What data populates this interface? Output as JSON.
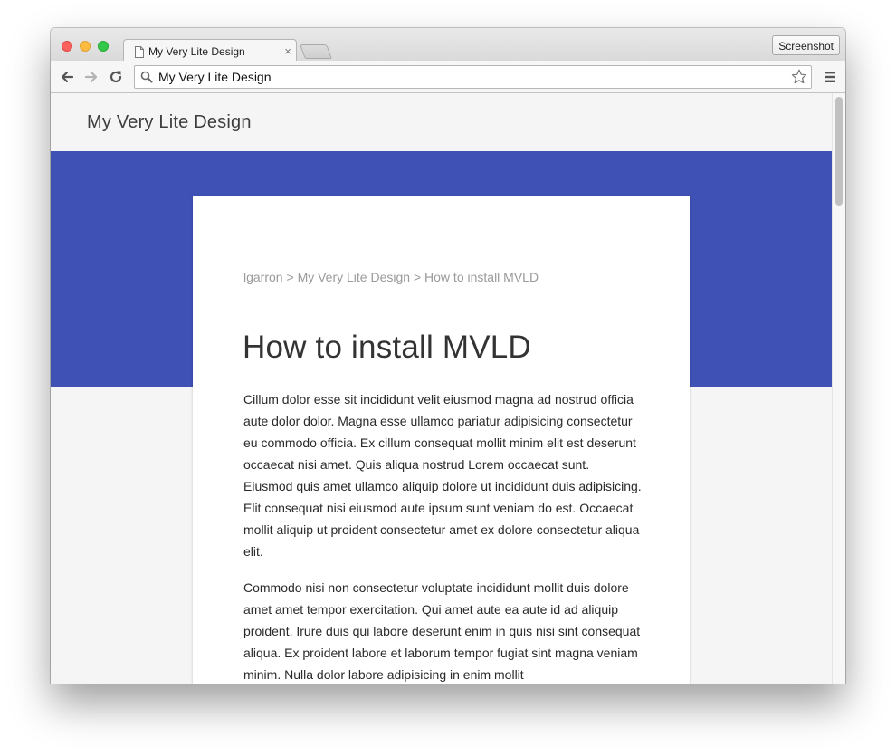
{
  "browser": {
    "tab_title": "My Very Lite Design",
    "tab_close": "×",
    "address": "My Very Lite Design",
    "screenshot_label": "Screenshot"
  },
  "site": {
    "title": "My Very Lite Design",
    "accent_color": "#3f51b5"
  },
  "breadcrumb": {
    "items": [
      "lgarron",
      "My Very Lite Design",
      "How to install MVLD"
    ],
    "separator": ">"
  },
  "article": {
    "title": "How to install MVLD",
    "paragraphs": [
      "Cillum dolor esse sit incididunt velit eiusmod magna ad nostrud officia aute dolor dolor. Magna esse ullamco pariatur adipisicing consectetur eu commodo officia. Ex cillum consequat mollit minim elit est deserunt occaecat nisi amet. Quis aliqua nostrud Lorem occaecat sunt. Eiusmod quis amet ullamco aliquip dolore ut incididunt duis adipisicing. Elit consequat nisi eiusmod aute ipsum sunt veniam do est. Occaecat mollit aliquip ut proident consectetur amet ex dolore consectetur aliqua elit.",
      "Commodo nisi non consectetur voluptate incididunt mollit duis dolore amet amet tempor exercitation. Qui amet aute ea aute id ad aliquip proident. Irure duis qui labore deserunt enim in quis nisi sint consequat aliqua. Ex proident labore et laborum tempor fugiat sint magna veniam minim. Nulla dolor labore adipisicing in enim mollit"
    ]
  }
}
